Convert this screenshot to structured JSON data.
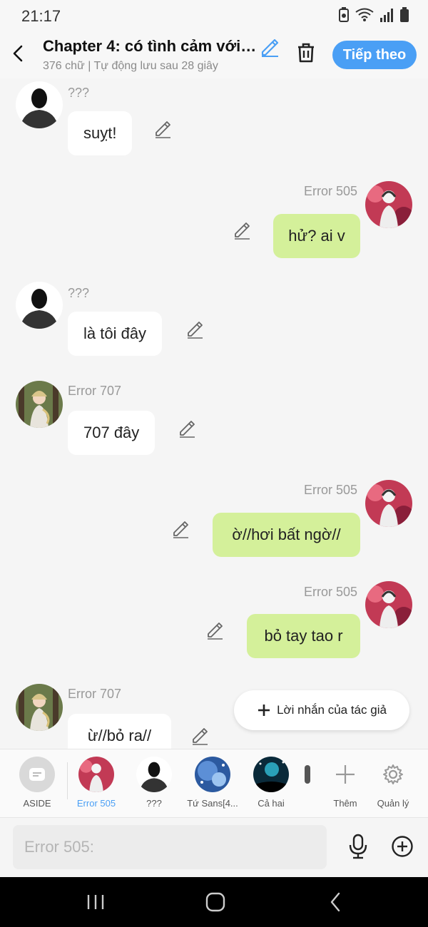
{
  "status_bar": {
    "time": "21:17"
  },
  "header": {
    "title": "Chapter 4: có tình cảm với ...",
    "subtitle": "376 chữ | Tự động lưu sau 28 giây",
    "next_label": "Tiếp theo"
  },
  "messages": [
    {
      "sender": "???",
      "text": "suỵt!"
    },
    {
      "sender": "Error 505",
      "text": "hử? ai v"
    },
    {
      "sender": "???",
      "text": "là tôi đây"
    },
    {
      "sender": "Error 707",
      "text": "707 đây"
    },
    {
      "sender": "Error 505",
      "text": "ờ//hơi bất ngờ//"
    },
    {
      "sender": "Error 505",
      "text": "bỏ tay tao r"
    },
    {
      "sender": "Error 707",
      "text": "ừ//bỏ ra//"
    }
  ],
  "author_note": {
    "label": "Lời nhắn của tác giả"
  },
  "characters": [
    {
      "label": "ASIDE"
    },
    {
      "label": "Error 505"
    },
    {
      "label": "???"
    },
    {
      "label": "Tứ Sans[4..."
    },
    {
      "label": "Cả hai"
    }
  ],
  "actions": {
    "add_label": "Thêm",
    "manage_label": "Quản lý"
  },
  "composer": {
    "placeholder": "Error 505:"
  },
  "colors": {
    "accent": "#4a9ff5",
    "outgoing_bubble": "#d4f09a",
    "incoming_bubble": "#ffffff"
  }
}
